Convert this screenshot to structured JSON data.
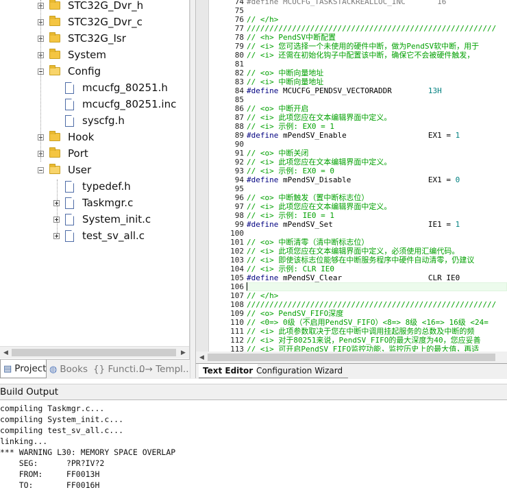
{
  "project_tree": {
    "items": [
      {
        "label": "STC32G_Dvr_h",
        "kind": "folder",
        "expander": "plus"
      },
      {
        "label": "STC32G_Dvr_c",
        "kind": "folder",
        "expander": "plus"
      },
      {
        "label": "STC32G_Isr",
        "kind": "folder",
        "expander": "plus"
      },
      {
        "label": "System",
        "kind": "folder",
        "expander": "plus"
      },
      {
        "label": "Config",
        "kind": "folder-open",
        "expander": "minus"
      },
      {
        "label": "mcucfg_80251.h",
        "kind": "file"
      },
      {
        "label": "mcucfg_80251.inc",
        "kind": "file"
      },
      {
        "label": "syscfg.h",
        "kind": "file"
      },
      {
        "label": "Hook",
        "kind": "folder",
        "expander": "plus"
      },
      {
        "label": "Port",
        "kind": "folder",
        "expander": "plus"
      },
      {
        "label": "User",
        "kind": "folder-open",
        "expander": "minus"
      },
      {
        "label": "typedef.h",
        "kind": "file"
      },
      {
        "label": "Taskmgr.c",
        "kind": "file",
        "expander": "plus"
      },
      {
        "label": "System_init.c",
        "kind": "file",
        "expander": "plus"
      },
      {
        "label": "test_sv_all.c",
        "kind": "file",
        "expander": "plus"
      }
    ]
  },
  "project_tabs": [
    {
      "label": "Project",
      "icon": "project-icon",
      "active": true
    },
    {
      "label": "Books",
      "icon": "books-icon",
      "active": false
    },
    {
      "label": "{} Functi...",
      "icon": "functions-icon",
      "active": false
    },
    {
      "label": "0→ Templ...",
      "icon": "templates-icon",
      "active": false
    }
  ],
  "editor": {
    "lines": [
      {
        "n": "74",
        "parts": [
          [
            "dim",
            "#define MCUCFG_TASKSTACKREALLOC_INC       16"
          ]
        ]
      },
      {
        "n": "75",
        "parts": [
          [
            "txt",
            ""
          ]
        ]
      },
      {
        "n": "76",
        "parts": [
          [
            "com",
            "// </h>"
          ]
        ]
      },
      {
        "n": "77",
        "parts": [
          [
            "com",
            "///////////////////////////////////////////////////////"
          ]
        ]
      },
      {
        "n": "78",
        "parts": [
          [
            "com",
            "// <h> PendSV中断配置"
          ]
        ]
      },
      {
        "n": "79",
        "parts": [
          [
            "com",
            "// <i> 您可选择一个未使用的硬件中断，做为PendSV软中断，用于"
          ]
        ]
      },
      {
        "n": "80",
        "parts": [
          [
            "com",
            "// <i> 还需在初始化钩子中配置该中断，确保它不会被硬件触发，"
          ]
        ]
      },
      {
        "n": "81",
        "parts": [
          [
            "txt",
            ""
          ]
        ]
      },
      {
        "n": "82",
        "parts": [
          [
            "com",
            "// <o> 中断向量地址"
          ]
        ]
      },
      {
        "n": "83",
        "parts": [
          [
            "com",
            "// <i> 中断向量地址"
          ]
        ]
      },
      {
        "n": "84",
        "parts": [
          [
            "def",
            "#define "
          ],
          [
            "txt",
            "MCUCFG_PENDSV_VECTORADDR        "
          ],
          [
            "num",
            "13H"
          ]
        ]
      },
      {
        "n": "85",
        "parts": [
          [
            "txt",
            ""
          ]
        ]
      },
      {
        "n": "86",
        "parts": [
          [
            "com",
            "// <o> 中断开启"
          ]
        ]
      },
      {
        "n": "87",
        "parts": [
          [
            "com",
            "// <i> 此项您应在文本编辑界面中定义。"
          ]
        ]
      },
      {
        "n": "88",
        "parts": [
          [
            "com",
            "// <i> 示例: EX0 = 1"
          ]
        ]
      },
      {
        "n": "89",
        "parts": [
          [
            "def",
            "#define "
          ],
          [
            "txt",
            "mPendSV_Enable                  EX1 = "
          ],
          [
            "num",
            "1"
          ]
        ]
      },
      {
        "n": "90",
        "parts": [
          [
            "txt",
            ""
          ]
        ]
      },
      {
        "n": "91",
        "parts": [
          [
            "com",
            "// <o> 中断关闭"
          ]
        ]
      },
      {
        "n": "92",
        "parts": [
          [
            "com",
            "// <i> 此项您应在文本编辑界面中定义。"
          ]
        ]
      },
      {
        "n": "93",
        "parts": [
          [
            "com",
            "// <i> 示例: EX0 = 0"
          ]
        ]
      },
      {
        "n": "94",
        "parts": [
          [
            "def",
            "#define "
          ],
          [
            "txt",
            "mPendSV_Disable                 EX1 = "
          ],
          [
            "num",
            "0"
          ]
        ]
      },
      {
        "n": "95",
        "parts": [
          [
            "txt",
            ""
          ]
        ]
      },
      {
        "n": "96",
        "parts": [
          [
            "com",
            "// <o> 中断触发（置中断标志位）"
          ]
        ]
      },
      {
        "n": "97",
        "parts": [
          [
            "com",
            "// <i> 此项您应在文本编辑界面中定义。"
          ]
        ]
      },
      {
        "n": "98",
        "parts": [
          [
            "com",
            "// <i> 示例: IE0 = 1"
          ]
        ]
      },
      {
        "n": "99",
        "parts": [
          [
            "def",
            "#define "
          ],
          [
            "txt",
            "mPendSV_Set                     IE1 = "
          ],
          [
            "num",
            "1"
          ]
        ]
      },
      {
        "n": "100",
        "parts": [
          [
            "txt",
            ""
          ]
        ]
      },
      {
        "n": "101",
        "parts": [
          [
            "com",
            "// <o> 中断清零（清中断标志位）"
          ]
        ]
      },
      {
        "n": "102",
        "parts": [
          [
            "com",
            "// <i> 此项您应在文本编辑界面中定义，必须使用汇编代码。"
          ]
        ]
      },
      {
        "n": "103",
        "parts": [
          [
            "com",
            "// <i> 即使该标志位能够在中断服务程序中硬件自动清零，仍建议"
          ]
        ]
      },
      {
        "n": "104",
        "parts": [
          [
            "com",
            "// <i> 示例: CLR IE0"
          ]
        ]
      },
      {
        "n": "105",
        "parts": [
          [
            "def",
            "#define "
          ],
          [
            "txt",
            "mPendSV_Clear                   CLR IE0"
          ]
        ]
      },
      {
        "n": "106",
        "parts": [
          [
            "txt",
            ""
          ]
        ]
      },
      {
        "n": "107",
        "parts": [
          [
            "com",
            "// </h>"
          ]
        ]
      },
      {
        "n": "108",
        "parts": [
          [
            "com",
            "///////////////////////////////////////////////////////"
          ]
        ]
      },
      {
        "n": "109",
        "parts": [
          [
            "com",
            "// <o> PendSV_FIFO深度"
          ]
        ]
      },
      {
        "n": "110",
        "parts": [
          [
            "com",
            "// <0=> 0级（不启用PendSV_FIFO）<8=> 8级 <16=> 16级 <24="
          ]
        ]
      },
      {
        "n": "111",
        "parts": [
          [
            "com",
            "// <i> 此项参数取决于您在中断中调用挂起服务的总数及中断的频"
          ]
        ]
      },
      {
        "n": "112",
        "parts": [
          [
            "com",
            "// <i> 对于80251来说，PendSV_FIFO的最大深度为40，您应妥善"
          ]
        ]
      },
      {
        "n": "113",
        "parts": [
          [
            "com",
            "// <i> 可开启PendSV_FIFO监控功能，监控历史上的最大值，再适"
          ]
        ]
      }
    ]
  },
  "editor_tabs": [
    {
      "label": "Text Editor",
      "active": true
    },
    {
      "label": "Configuration Wizard",
      "active": false
    }
  ],
  "build_output": {
    "title": "Build Output",
    "lines": [
      "compiling Taskmgr.c...",
      "compiling System_init.c...",
      "compiling test_sv_all.c...",
      "linking...",
      "*** WARNING L30: MEMORY SPACE OVERLAP",
      "    SEG:      ?PR?IV?2",
      "    FROM:     FF0013H",
      "    TO:       FF0016H"
    ]
  }
}
